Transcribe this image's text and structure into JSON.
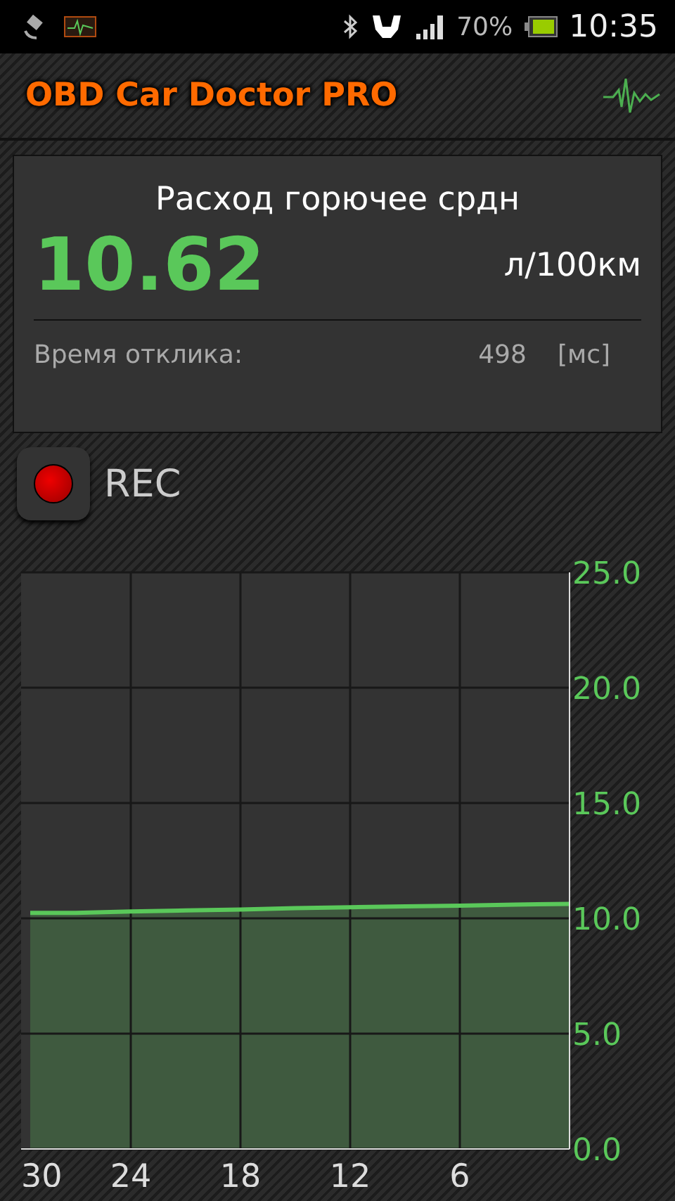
{
  "status_bar": {
    "battery": "70%",
    "time": "10:35"
  },
  "header": {
    "title": "OBD Car Doctor PRO"
  },
  "sensor": {
    "name": "Расход горючее срдн",
    "value": "10.62",
    "unit": "л/100км",
    "response_label": "Время отклика:",
    "response_value": "498",
    "response_unit": "[мс]"
  },
  "record": {
    "label": "REC"
  },
  "chart_data": {
    "type": "area",
    "x": [
      29.5,
      27,
      24,
      21,
      18,
      15,
      12,
      9,
      6,
      3,
      0
    ],
    "grid": true,
    "series": [
      {
        "color": "#5ac85a",
        "values": [
          10.24,
          10.24,
          10.3,
          10.34,
          10.38,
          10.44,
          10.48,
          10.52,
          10.55,
          10.6,
          10.62
        ]
      }
    ],
    "xlim": [
      30,
      0
    ],
    "ylim": [
      0,
      25
    ],
    "xticks": [
      30,
      24,
      18,
      12,
      6
    ],
    "yticks": [
      {
        "value": 0,
        "label": "0.0"
      },
      {
        "value": 5,
        "label": "5.0"
      },
      {
        "value": 10,
        "label": "10.0"
      },
      {
        "value": 15,
        "label": "15.0"
      },
      {
        "value": 20,
        "label": "20.0"
      },
      {
        "value": 25,
        "label": "25.0"
      }
    ]
  }
}
